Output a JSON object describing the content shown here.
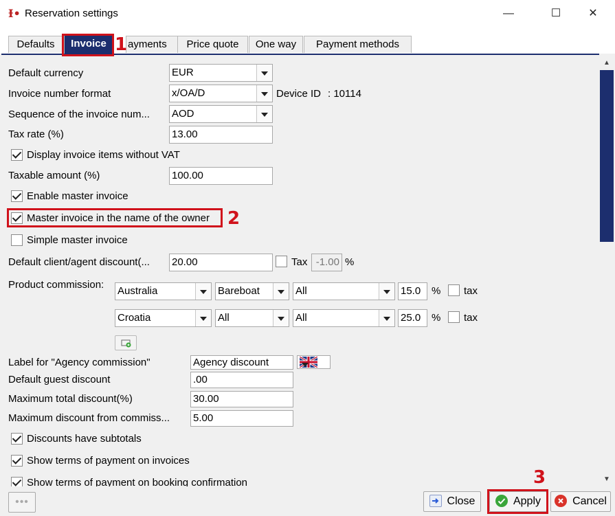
{
  "window": {
    "title": "Reservation settings",
    "minimize": "—",
    "maximize": "☐",
    "close": "✕"
  },
  "tabs": [
    {
      "label": "Defaults"
    },
    {
      "label": "Invoice"
    },
    {
      "label": "ayments"
    },
    {
      "label": "Price quote"
    },
    {
      "label": "One way"
    },
    {
      "label": "Payment methods"
    }
  ],
  "annotations": {
    "step1": "1",
    "step2": "2",
    "step3": "3"
  },
  "form": {
    "default_currency": {
      "label": "Default currency",
      "value": "EUR"
    },
    "invoice_number_format": {
      "label": "Invoice number format",
      "value": "x/OA/D"
    },
    "device_id": {
      "label": "Device ID",
      "value": ": 10114"
    },
    "sequence": {
      "label": "Sequence of the invoice num...",
      "value": "AOD"
    },
    "tax_rate": {
      "label": "Tax rate  (%)",
      "value": "13.00"
    },
    "display_without_vat": {
      "label": "Display invoice items without VAT",
      "checked": true
    },
    "taxable_amount": {
      "label": "Taxable amount (%)",
      "value": "100.00"
    },
    "enable_master_invoice": {
      "label": "Enable master invoice",
      "checked": true
    },
    "master_invoice_owner": {
      "label": "Master invoice in the name of the owner",
      "checked": true
    },
    "simple_master_invoice": {
      "label": "Simple master invoice",
      "checked": false
    },
    "default_discount": {
      "label": "Default client/agent discount(...",
      "value": "20.00",
      "tax_label": "Tax",
      "tax_value": "-1.00",
      "percent": "%"
    },
    "product_commission": {
      "label": "Product commission:",
      "rows": [
        {
          "country": "Australia",
          "type": "Bareboat",
          "scope": "All",
          "value": "15.0",
          "percent": "%",
          "tax": "tax"
        },
        {
          "country": "Croatia",
          "type": "All",
          "scope": "All",
          "value": "25.0",
          "percent": "%",
          "tax": "tax"
        }
      ]
    },
    "agency_commission_label": {
      "label": "Label for \"Agency commission\"",
      "value": "Agency discount"
    },
    "default_guest_discount": {
      "label": "Default guest discount",
      "value": ".00"
    },
    "max_total_discount": {
      "label": "Maximum total discount(%)",
      "value": "30.00"
    },
    "max_discount_commission": {
      "label": "Maximum discount from commiss...",
      "value": "5.00"
    },
    "discounts_subtotals": {
      "label": "Discounts have subtotals",
      "checked": true
    },
    "terms_on_invoices": {
      "label": "Show terms of payment on invoices",
      "checked": true
    },
    "terms_on_booking": {
      "label": "Show terms of payment on booking confirmation",
      "checked": true
    }
  },
  "footer": {
    "more": "•••",
    "close": "Close",
    "apply": "Apply",
    "cancel": "Cancel"
  },
  "colors": {
    "accent": "#1c2e6e",
    "annotation": "#d0121b",
    "apply_icon": "#3aa63a",
    "cancel_icon": "#d9332a"
  }
}
